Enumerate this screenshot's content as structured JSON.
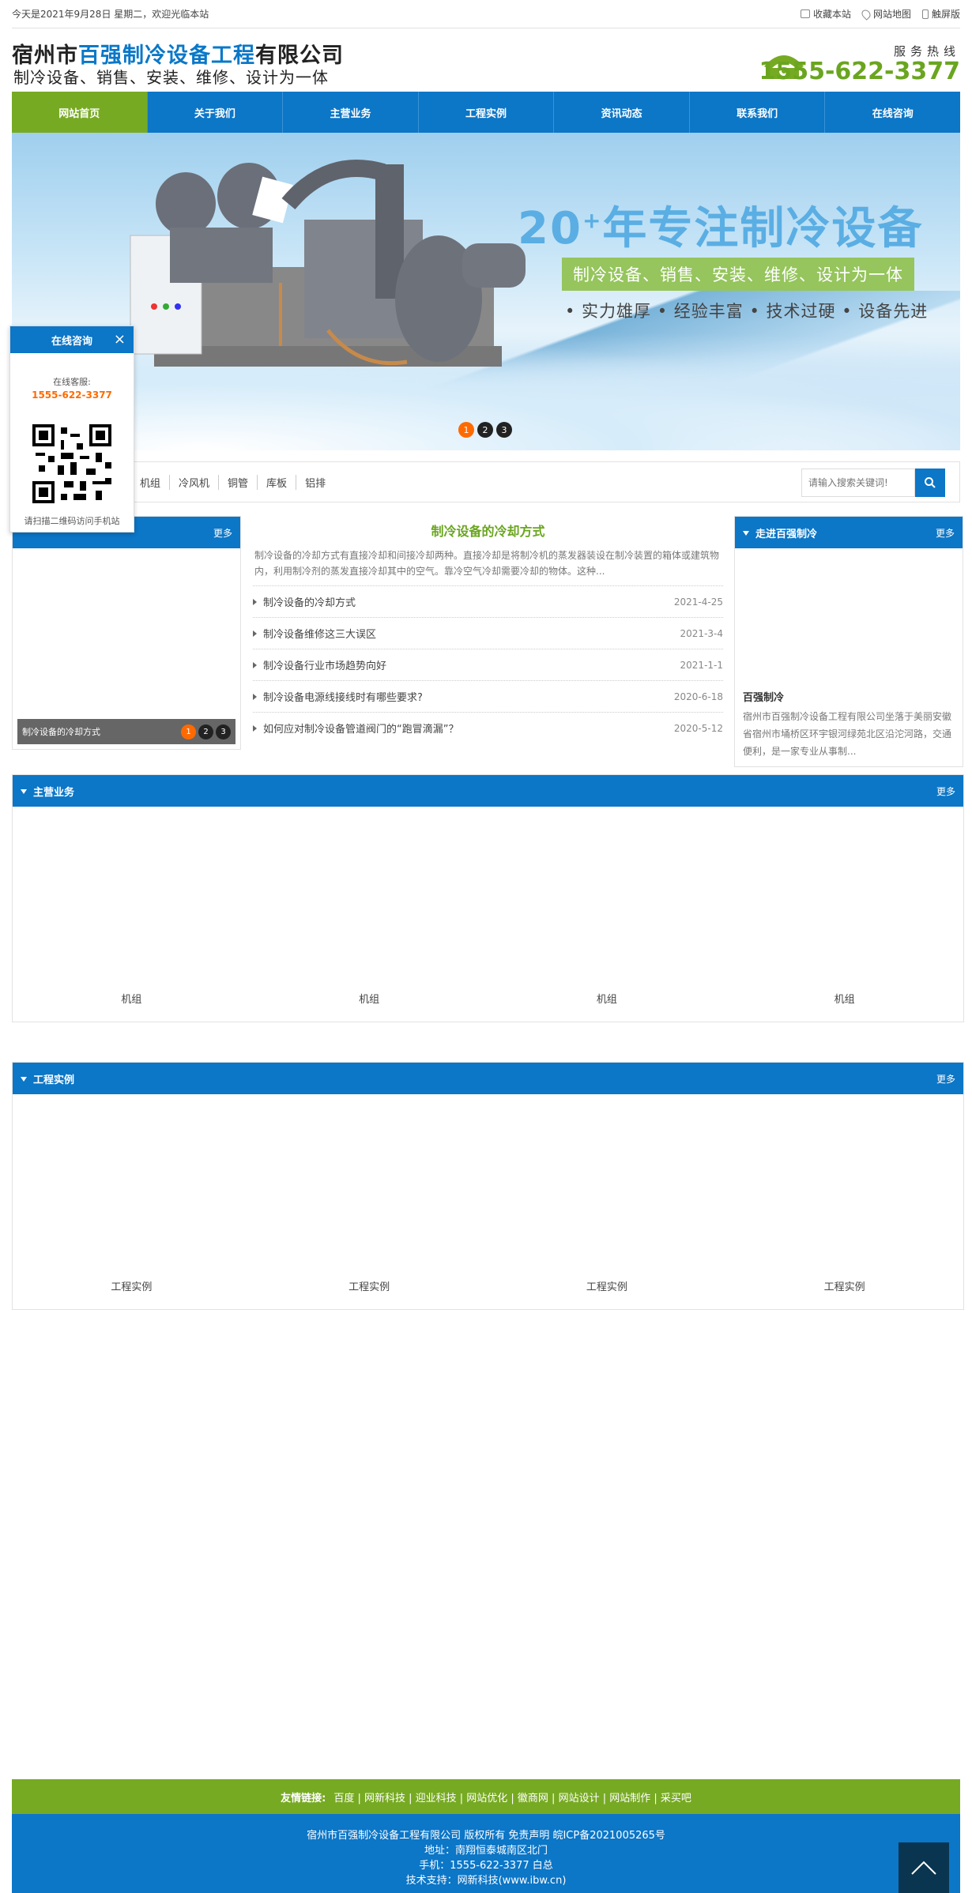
{
  "topbar": {
    "welcome": "今天是2021年9月28日 星期二，欢迎光临本站",
    "fav": "收藏本站",
    "sitemap": "网站地图",
    "touch": "触屏版"
  },
  "header": {
    "title_a": "宿州市",
    "title_hl": "百强制冷设备工程",
    "title_b": "有限公司",
    "subtitle": "制冷设备、销售、安装、维修、设计为一体",
    "hotline_label": "服务热线",
    "hotline": "1555-622-3377"
  },
  "nav": [
    "网站首页",
    "关于我们",
    "主营业务",
    "工程实例",
    "资讯动态",
    "联系我们",
    "在线咨询"
  ],
  "banner": {
    "title": "20",
    "title_sup": "+",
    "title_rest": "年专注制冷设备",
    "tag": "制冷设备、销售、安装、维修、设计为一体",
    "features": "• 实力雄厚 • 经验丰富 • 技术过硬 • 设备先进",
    "dots": [
      "1",
      "2",
      "3"
    ]
  },
  "search": {
    "cats": [
      "机组",
      "冷风机",
      "铜管",
      "库板",
      "铝排"
    ],
    "placeholder": "请输入搜索关键词!"
  },
  "left_news": {
    "more": "更多",
    "caption": "制冷设备的冷却方式",
    "dots": [
      "1",
      "2",
      "3"
    ]
  },
  "center_news": {
    "title": "制冷设备的冷却方式",
    "intro": "制冷设备的冷却方式有直接冷却和间接冷却两种。直接冷却是将制冷机的蒸发器装设在制冷装置的箱体或建筑物内，利用制冷剂的蒸发直接冷却其中的空气。靠冷空气冷却需要冷却的物体。这种...",
    "items": [
      {
        "t": "制冷设备的冷却方式",
        "d": "2021-4-25"
      },
      {
        "t": "制冷设备维修这三大误区",
        "d": "2021-3-4"
      },
      {
        "t": "制冷设备行业市场趋势向好",
        "d": "2021-1-1"
      },
      {
        "t": "制冷设备电源线接线时有哪些要求?",
        "d": "2020-6-18"
      },
      {
        "t": "如何应对制冷设备管道阀门的“跑冒滴漏”？",
        "d": "2020-5-12"
      }
    ]
  },
  "about": {
    "title": "走进百强制冷",
    "more": "更多",
    "name": "百强制冷",
    "text": "宿州市百强制冷设备工程有限公司坐落于美丽安徽省宿州市埇桥区环宇银河绿苑北区沿沱河路，交通便利，是一家专业从事制..."
  },
  "business": {
    "title": "主营业务",
    "more": "更多",
    "items": [
      "机组",
      "机组",
      "机组",
      "机组"
    ]
  },
  "cases": {
    "title": "工程实例",
    "more": "更多",
    "items": [
      "工程实例",
      "工程实例",
      "工程实例",
      "工程实例"
    ]
  },
  "float": {
    "title": "在线咨询",
    "close": "×",
    "svc": "在线客服:",
    "phone": "1555-622-3377",
    "qr_text": "请扫描二维码访问手机站"
  },
  "footer": {
    "links_label": "友情链接:",
    "links": "百度 | 网新科技 | 迎业科技 | 网站优化 | 徽商网 | 网站设计 | 网站制作 | 采买吧",
    "line1": "宿州市百强制冷设备工程有限公司   版权所有   免责声明   皖ICP备2021005265号",
    "line2": "地址：南翔恒泰城南区北门",
    "line3": "手机：1555-622-3377 白总",
    "line4": "技术支持：网新科技(www.ibw.cn)"
  }
}
